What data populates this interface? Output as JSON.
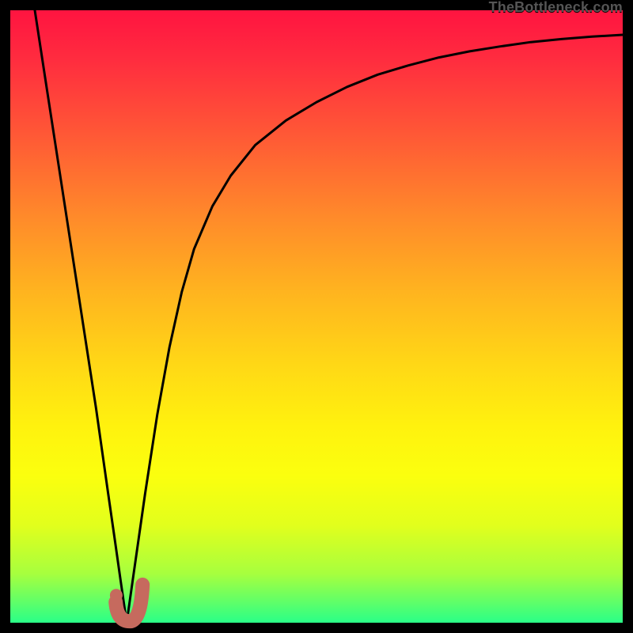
{
  "watermark": {
    "text": "TheBottleneck.com"
  },
  "chart_data": {
    "type": "line",
    "title": "",
    "xlabel": "",
    "ylabel": "",
    "xlim": [
      0,
      100
    ],
    "ylim": [
      0,
      100
    ],
    "grid": false,
    "legend": false,
    "series": [
      {
        "name": "bottleneck-curve",
        "x": [
          4,
          6,
          8,
          10,
          12,
          14,
          15,
          16,
          17,
          18,
          19,
          20,
          22,
          24,
          26,
          28,
          30,
          33,
          36,
          40,
          45,
          50,
          55,
          60,
          65,
          70,
          75,
          80,
          85,
          90,
          95,
          100
        ],
        "y": [
          100,
          87,
          74,
          61,
          48,
          35,
          28,
          21,
          14,
          7,
          0,
          7,
          21,
          34,
          45,
          54,
          61,
          68,
          73,
          78,
          82,
          85,
          87.5,
          89.5,
          91,
          92.3,
          93.3,
          94.1,
          94.8,
          95.3,
          95.7,
          96
        ]
      }
    ],
    "marker": {
      "name": "optimal-point",
      "x": 18.5,
      "y": 2
    },
    "gradient_colors": {
      "top": "#ff1440",
      "mid": "#fff20e",
      "bottom": "#2aff88"
    }
  }
}
